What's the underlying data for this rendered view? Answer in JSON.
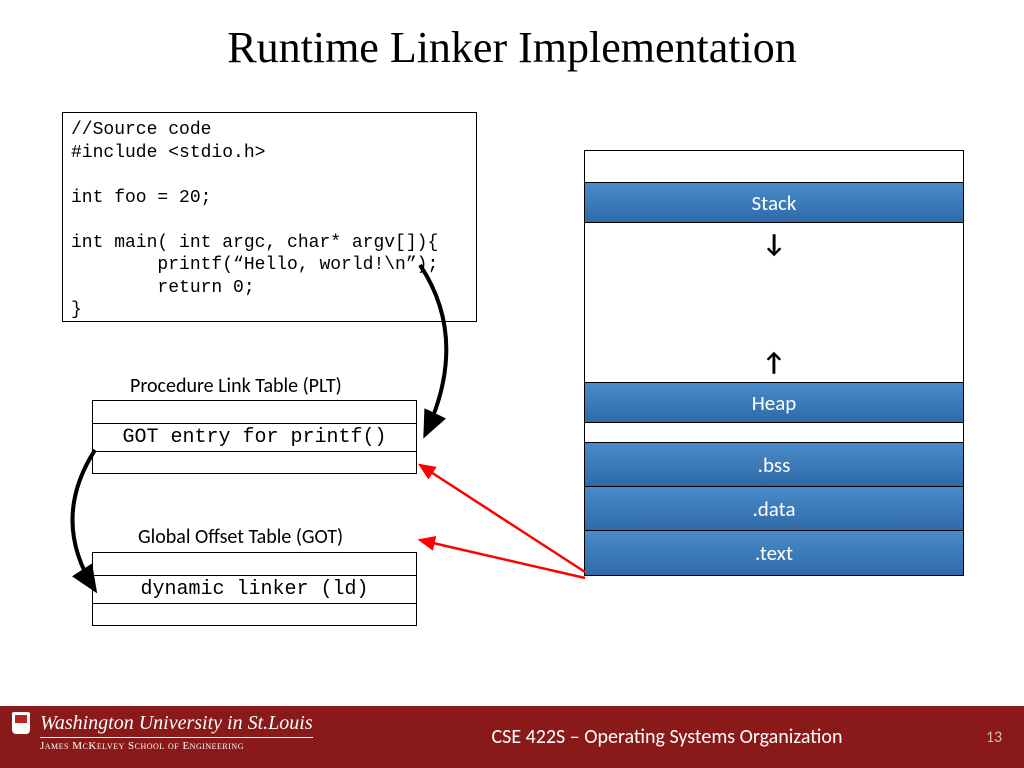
{
  "title": "Runtime Linker Implementation",
  "source_code": "//Source code\n#include <stdio.h>\n\nint foo = 20;\n\nint main( int argc, char* argv[]){\n        printf(“Hello, world!\\n”);\n        return 0;\n}",
  "plt": {
    "label": "Procedure Link Table (PLT)",
    "entry": "GOT entry for printf()"
  },
  "got": {
    "label": "Global Offset Table (GOT)",
    "entry": "dynamic linker (ld)"
  },
  "memory": {
    "stack": "Stack",
    "heap": "Heap",
    "bss": ".bss",
    "data": ".data",
    "text": ".text"
  },
  "footer": {
    "university": "Washington University in St.Louis",
    "school": "James McKelvey School of Engineering",
    "course": "CSE 422S – Operating Systems Organization",
    "page": "13"
  }
}
